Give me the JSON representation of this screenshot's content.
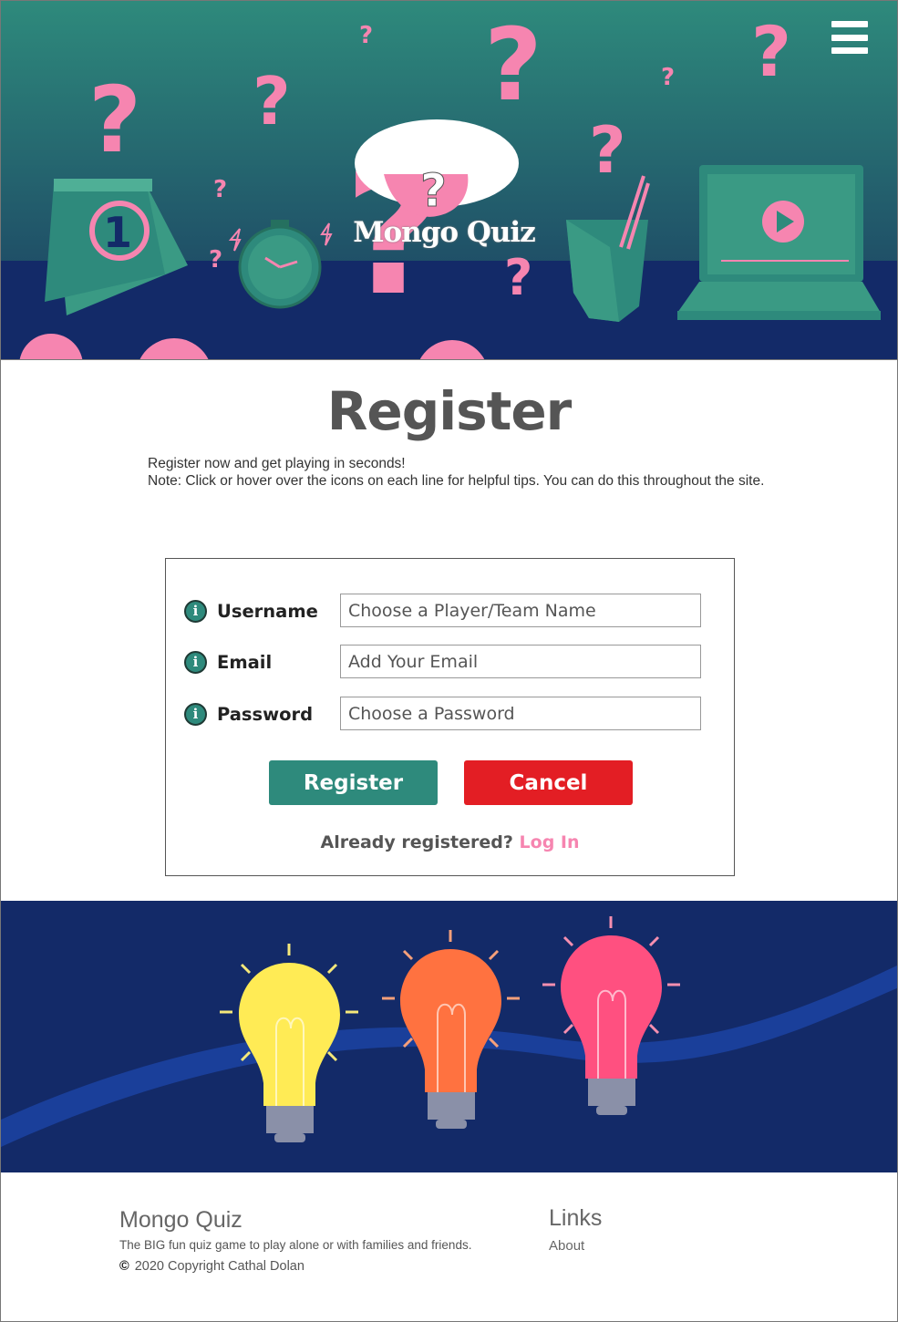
{
  "hero": {
    "brand": "Mongo Quiz",
    "menu_icon": "hamburger-menu-icon"
  },
  "register": {
    "title": "Register",
    "intro_line1": "Register now and get playing in seconds!",
    "intro_line2": "Note: Click or hover over the icons on each line for helpful tips. You can do this throughout the site."
  },
  "form": {
    "fields": [
      {
        "label": "Username",
        "placeholder": "Choose a Player/Team Name",
        "icon": "info-icon"
      },
      {
        "label": "Email",
        "placeholder": "Add Your Email",
        "icon": "info-icon"
      },
      {
        "label": "Password",
        "placeholder": "Choose a Password",
        "icon": "info-icon"
      }
    ],
    "register_label": "Register",
    "cancel_label": "Cancel",
    "already_text": "Already registered?",
    "login_label": "Log In"
  },
  "footer": {
    "title": "Mongo Quiz",
    "description": "The BIG fun quiz game to play alone or with families and friends.",
    "copyright_symbol": "©",
    "copyright": "2020 Copyright Cathal Dolan",
    "links_title": "Links",
    "about_label": "About"
  },
  "colors": {
    "teal": "#2e8a7c",
    "navy": "#132a68",
    "pink": "#f685b0",
    "cancel_red": "#e31e24"
  }
}
